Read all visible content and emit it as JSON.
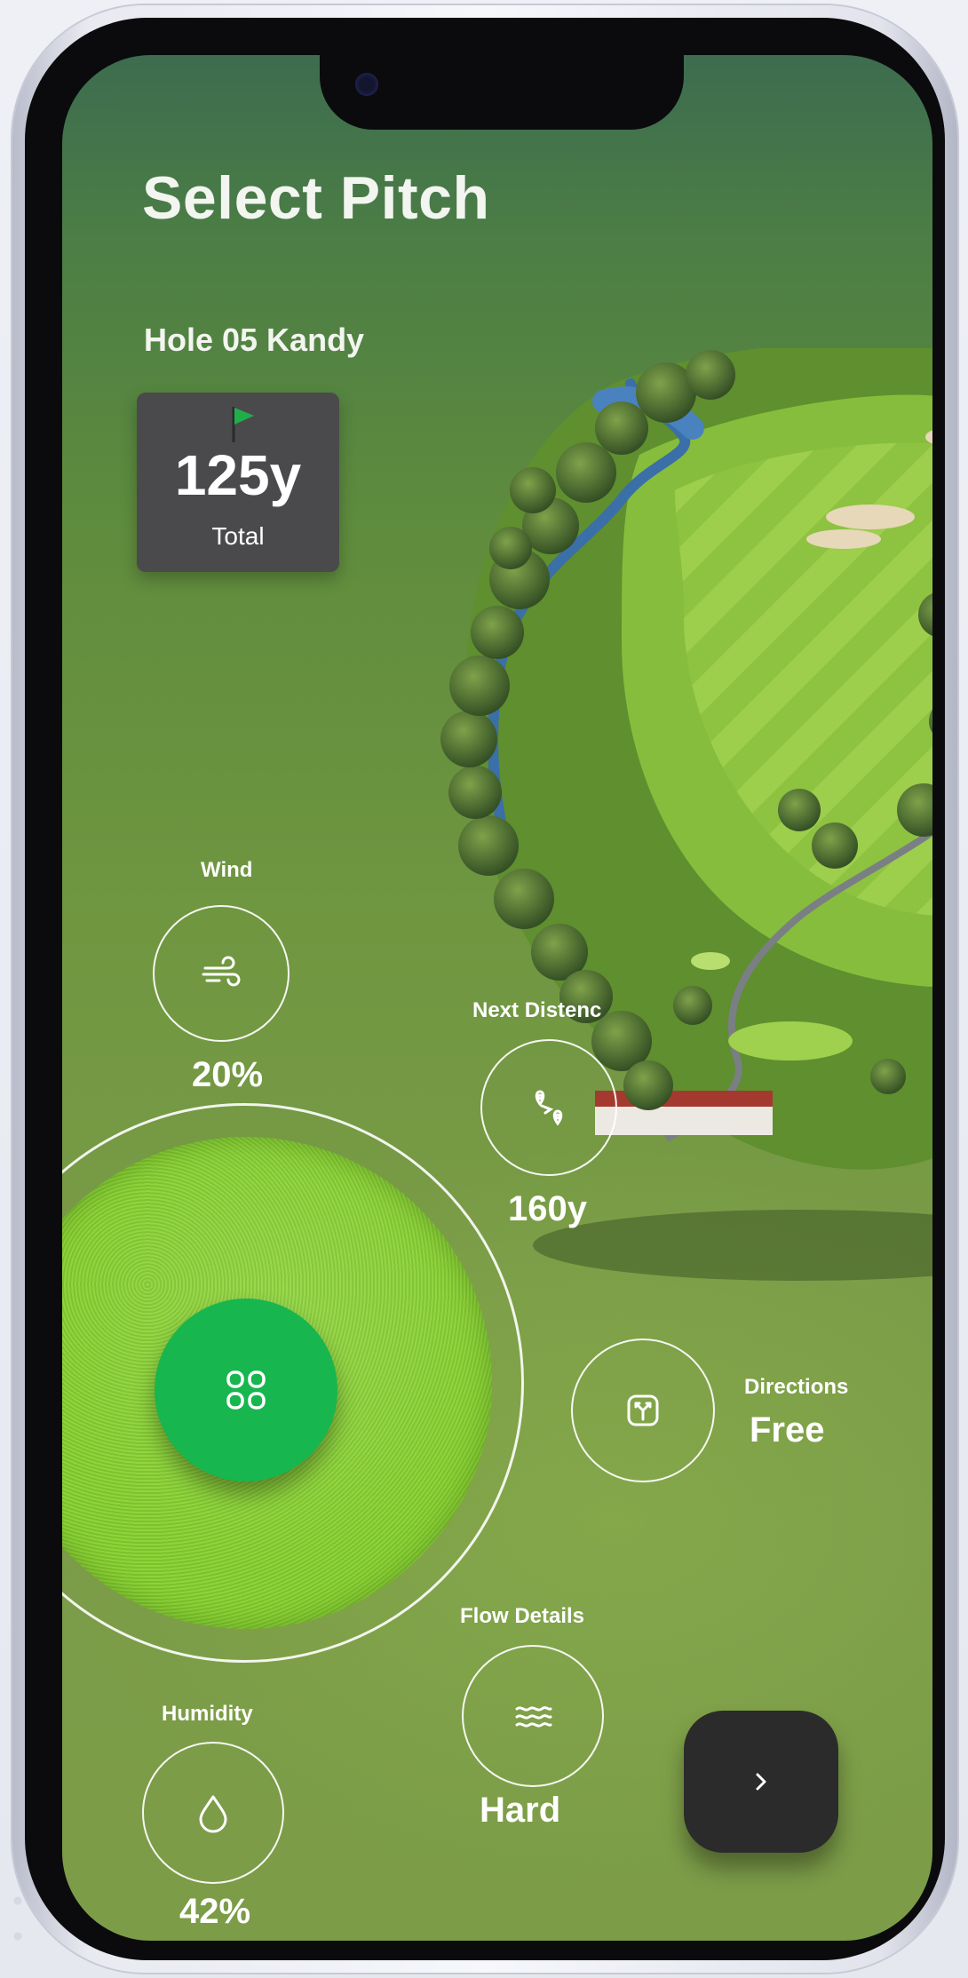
{
  "header": {
    "title": "Select Pitch"
  },
  "hole": {
    "name": "Hole 05 Kandy"
  },
  "distance_card": {
    "value": "125y",
    "label": "Total"
  },
  "stats": {
    "wind": {
      "label": "Wind",
      "value": "20%",
      "icon": "wind-icon"
    },
    "next_distance": {
      "label": "Next Distenc",
      "value": "160y",
      "icon": "route-icon"
    },
    "directions": {
      "label": "Directions",
      "value": "Free",
      "icon": "fork-arrow-icon"
    },
    "flow_details": {
      "label": "Flow Details",
      "value": "Hard",
      "icon": "waves-icon"
    },
    "humidity": {
      "label": "Humidity",
      "value": "42%",
      "icon": "droplet-icon"
    }
  },
  "center_button": {
    "icon": "grid-menu-icon"
  },
  "next_button": {
    "icon": "chevron-right-icon"
  },
  "colors": {
    "accent_green": "#17b64f",
    "flag_green": "#1fae4a",
    "card_bg": "#4a4a4c",
    "next_button_bg": "#2b2b2b"
  }
}
